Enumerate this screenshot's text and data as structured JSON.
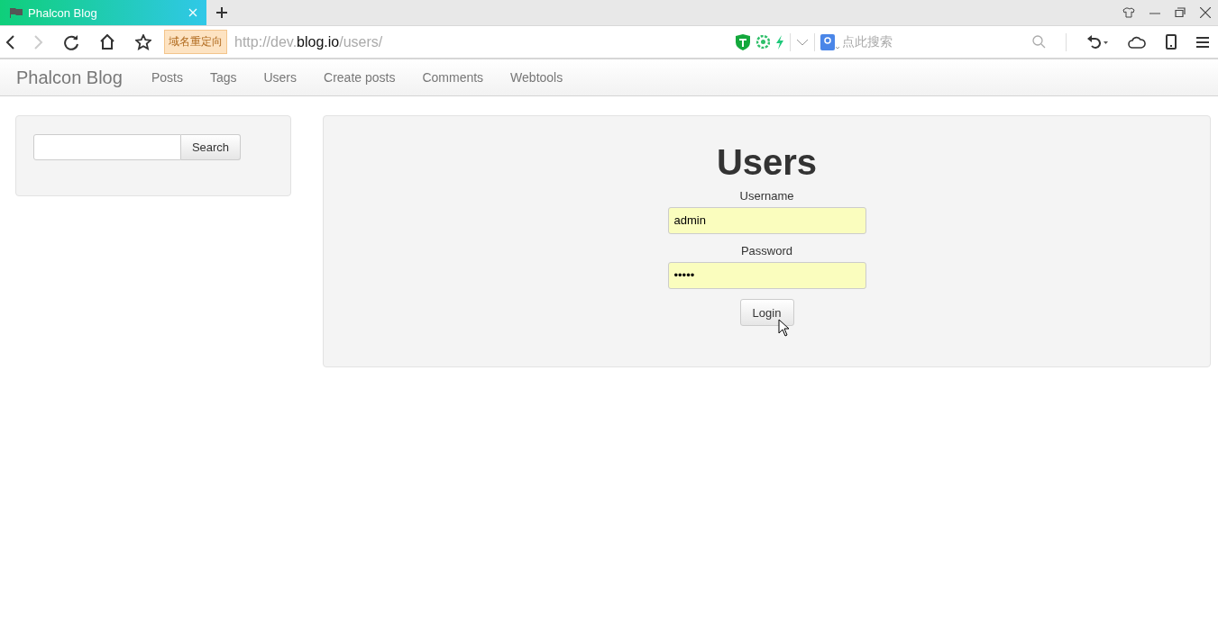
{
  "browser": {
    "tab_title": "Phalcon Blog",
    "redirect_badge": "域名重定向",
    "url": "http://dev.blog.io/users/",
    "search_placeholder": "点此搜索"
  },
  "navbar": {
    "brand": "Phalcon Blog",
    "items": [
      "Posts",
      "Tags",
      "Users",
      "Create posts",
      "Comments",
      "Webtools"
    ]
  },
  "sidebar": {
    "search_button": "Search"
  },
  "main": {
    "title": "Users",
    "fields": [
      {
        "label": "Username",
        "value": "admin",
        "autofilled": true
      },
      {
        "label": "Password",
        "value": "•••••",
        "autofilled": true
      }
    ],
    "button": "Login"
  }
}
